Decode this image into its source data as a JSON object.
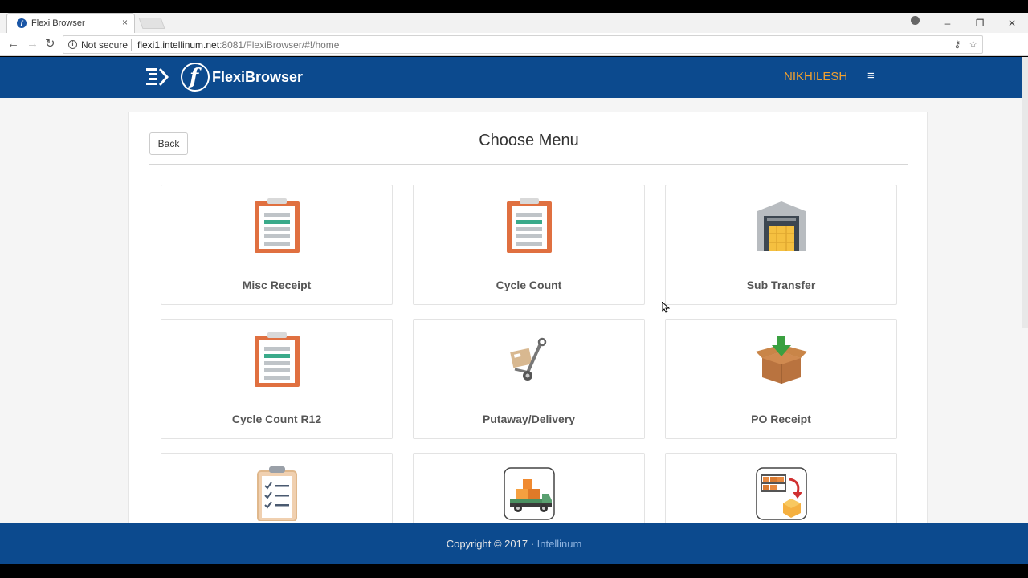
{
  "browser": {
    "tab_title": "Flexi Browser",
    "tab_close": "×",
    "not_secure": "Not secure",
    "url_host": "flexi1.intellinum.net",
    "url_rest": ":8081/FlexiBrowser/#!/home",
    "window_controls": [
      "–",
      "❐",
      "✕"
    ]
  },
  "header": {
    "logo_text": "FlexiBrowser",
    "user_name": "NIKHILESH",
    "menu_icon": "hamburger-icon"
  },
  "panel": {
    "back_label": "Back",
    "title": "Choose Menu"
  },
  "tiles": [
    {
      "label": "Misc Receipt",
      "icon": "clipboard-icon"
    },
    {
      "label": "Cycle Count",
      "icon": "clipboard-icon"
    },
    {
      "label": "Sub Transfer",
      "icon": "warehouse-icon"
    },
    {
      "label": "Cycle Count R12",
      "icon": "clipboard-icon"
    },
    {
      "label": "Putaway/Delivery",
      "icon": "hand-truck-icon"
    },
    {
      "label": "PO Receipt",
      "icon": "box-download-icon"
    },
    {
      "label": "",
      "icon": "checklist-icon"
    },
    {
      "label": "",
      "icon": "delivery-truck-icon"
    },
    {
      "label": "",
      "icon": "shelf-transfer-icon"
    }
  ],
  "footer": {
    "text": "Copyright © 2017 · ",
    "brand": "Intellinum"
  },
  "colors": {
    "brand_blue": "#0c4a8e",
    "user_orange": "#f0a030",
    "clipboard_orange": "#e07040",
    "clipboard_green": "#3aaa8a"
  }
}
